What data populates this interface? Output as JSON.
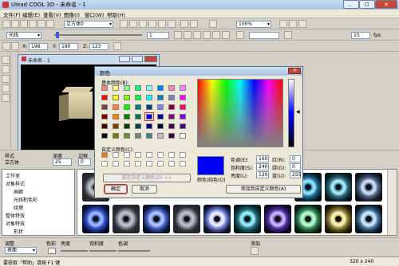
{
  "window": {
    "title": "Ulead COOL 3D - 未命名 - 1"
  },
  "menu": [
    "文件(F)",
    "编辑(E)",
    "查看(V)",
    "图像(I)",
    "窗口(W)",
    "帮助(H)"
  ],
  "toolbar": {
    "object_combo": "光线",
    "preset_combo": "立方体0",
    "zoom_combo": "100%",
    "fps_value": "15",
    "fps_unit": "fps",
    "frame_value": "1"
  },
  "toolbar2": {
    "x_label": "X:",
    "x_value": "198",
    "y_label": "Y:",
    "y_value": "180",
    "z_label": "Z:",
    "z_value": "123"
  },
  "doc": {
    "title": "未命名 - 1"
  },
  "props": {
    "style_label": "样式",
    "style_value": "立方体",
    "depth_label": "深度",
    "depth_value": "25",
    "border_label": "边框",
    "border_value": "0"
  },
  "tree": [
    "工作室",
    "对象样式",
    "画廊",
    "光线和色彩",
    "纹理",
    "整体特效",
    "对象特效",
    "形状"
  ],
  "bottom": {
    "adjust_label": "调整",
    "adjust_value": "表面",
    "color_label": "色彩",
    "brightness_label": "亮度",
    "saturation_label": "饱和度",
    "hue_label": "色调",
    "add_label": "添加"
  },
  "status": {
    "help": "要获取「帮助」请按 F1 键",
    "size": "320 x 240"
  },
  "color_dialog": {
    "title": "颜色",
    "basic_label": "基本颜色(B):",
    "custom_label": "自定义颜色(C):",
    "define_button": "规定自定义颜色(D) >>",
    "ok": "确定",
    "cancel": "取消",
    "add_button": "添加到自定义颜色(A)",
    "color_solid_label": "颜色|纯色(O)",
    "hue_label": "色调(E):",
    "hue_value": "160",
    "sat_label": "饱和度(S):",
    "sat_value": "240",
    "lum_label": "亮度(L):",
    "lum_value": "120",
    "red_label": "红(R):",
    "red_value": "0",
    "green_label": "绿(G):",
    "green_value": "0",
    "blue_label": "蓝(U):",
    "blue_value": "255",
    "basic_colors": [
      "#ff8080",
      "#ffff80",
      "#80ff80",
      "#00ff80",
      "#80ffff",
      "#0080ff",
      "#ff80c0",
      "#ff80ff",
      "#ff0000",
      "#ffff00",
      "#80ff00",
      "#00ff40",
      "#00ffff",
      "#0080c0",
      "#8080c0",
      "#ff00ff",
      "#804040",
      "#ff8040",
      "#00ff00",
      "#008080",
      "#004080",
      "#8080ff",
      "#800040",
      "#ff0080",
      "#800000",
      "#ff8000",
      "#008000",
      "#008040",
      "#0000ff",
      "#0000a0",
      "#800080",
      "#8000ff",
      "#400000",
      "#804000",
      "#004000",
      "#004040",
      "#000080",
      "#000040",
      "#400040",
      "#400080",
      "#000000",
      "#808000",
      "#808040",
      "#808080",
      "#408080",
      "#c0c0c0",
      "#400040",
      "#ffffff"
    ],
    "selected_color": "#0000ff",
    "custom_first": "#e87a1c"
  }
}
